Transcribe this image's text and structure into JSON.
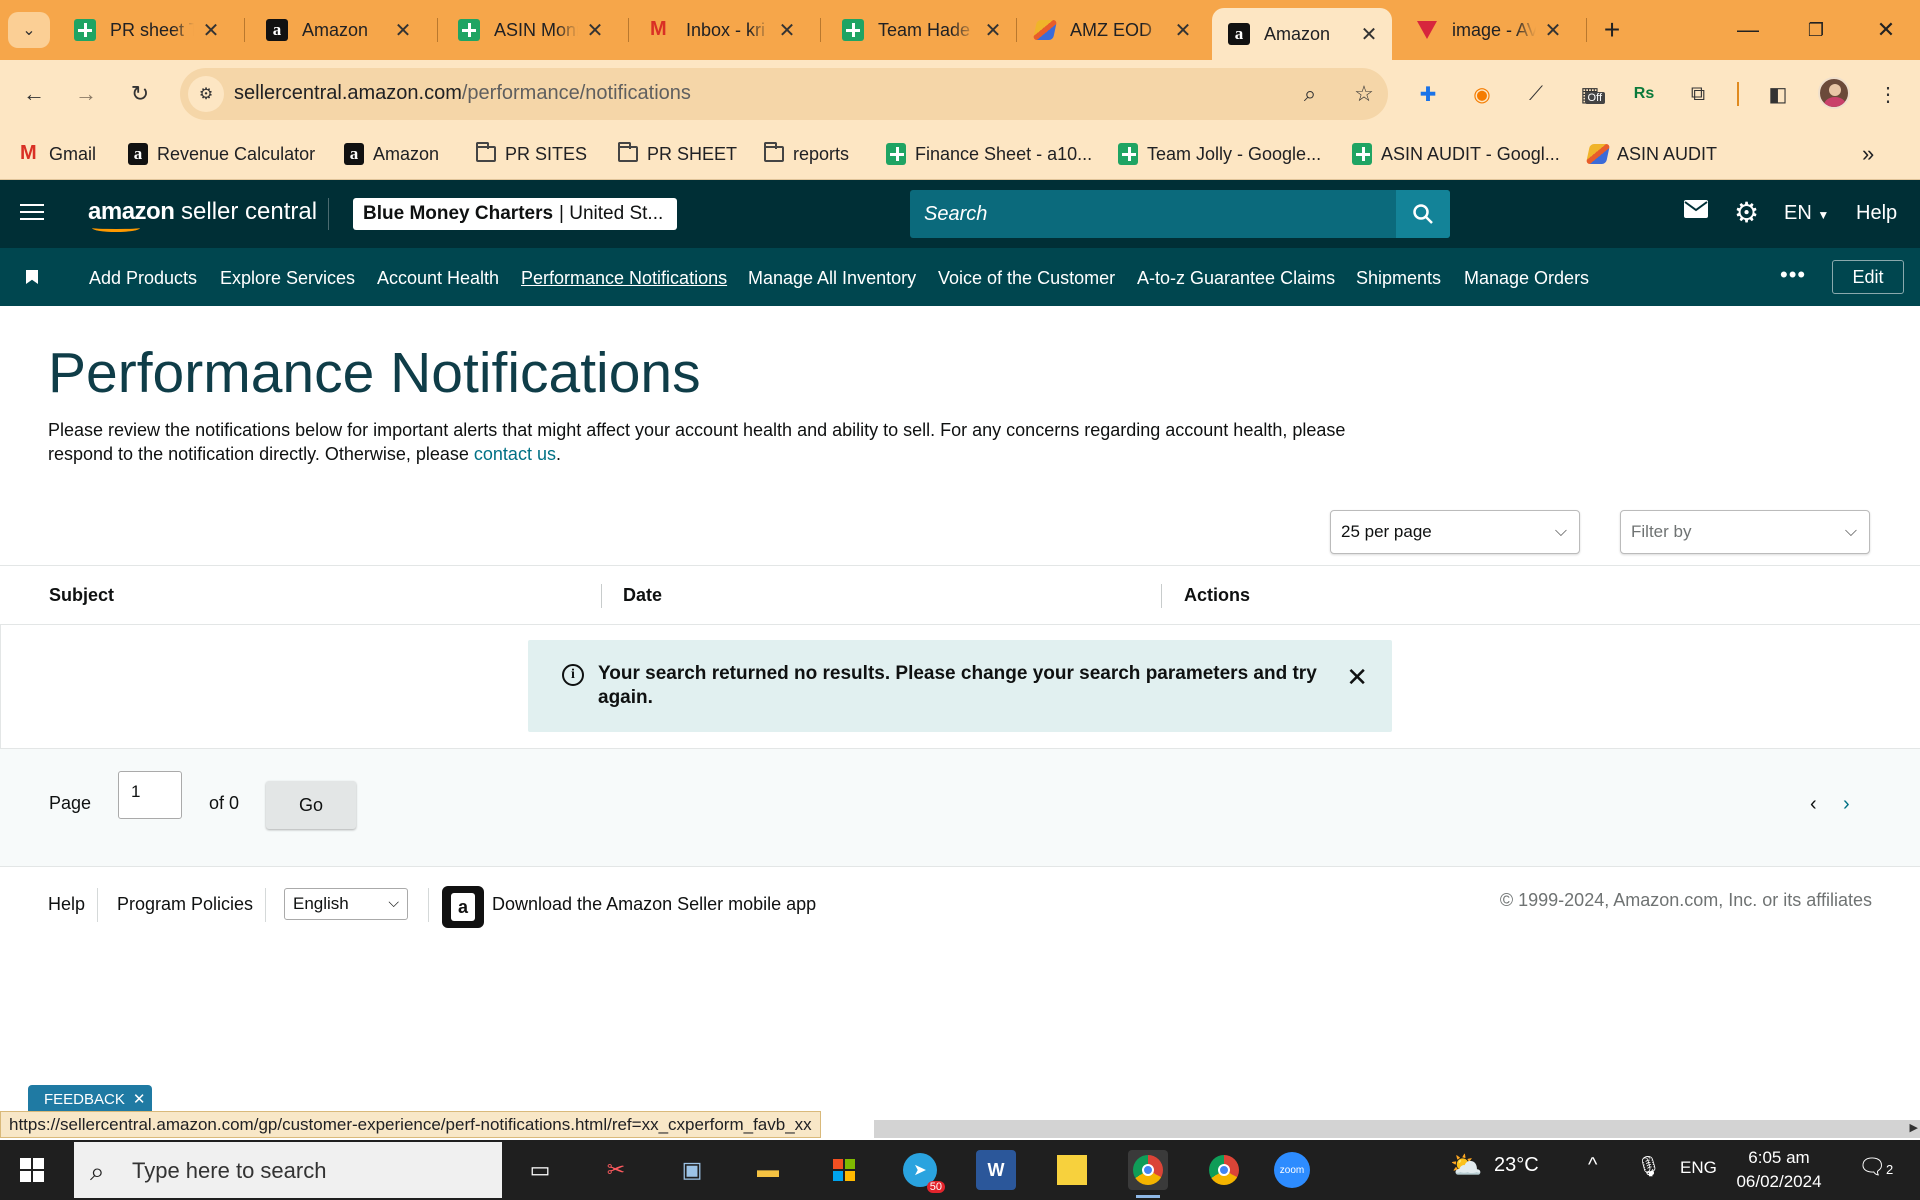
{
  "browser": {
    "tabs": [
      {
        "title": "PR sheet To",
        "icon": "sheets-icon"
      },
      {
        "title": "Amazon",
        "icon": "amazon-icon"
      },
      {
        "title": "ASIN Moni",
        "icon": "sheets-icon"
      },
      {
        "title": "Inbox - kri",
        "icon": "gmail-icon"
      },
      {
        "title": "Team Hade",
        "icon": "sheets-icon"
      },
      {
        "title": "AMZ EOD",
        "icon": "asin-audit-icon"
      },
      {
        "title": "Amazon",
        "icon": "amazon-icon",
        "active": true
      },
      {
        "title": "image - AV",
        "icon": "vpn-icon"
      }
    ],
    "url_host": "sellercentral.amazon.com",
    "url_path": "/performance/notifications",
    "bookmarks": [
      {
        "label": "Gmail",
        "icon": "gmail-icon"
      },
      {
        "label": "Revenue Calculator",
        "icon": "amazon-icon"
      },
      {
        "label": "Amazon",
        "icon": "amazon-icon"
      },
      {
        "label": "PR SITES",
        "icon": "folder-icon"
      },
      {
        "label": "PR SHEET",
        "icon": "folder-icon"
      },
      {
        "label": "reports",
        "icon": "folder-icon"
      },
      {
        "label": "Finance Sheet - a10...",
        "icon": "sheets-icon"
      },
      {
        "label": "Team Jolly - Google...",
        "icon": "sheets-icon"
      },
      {
        "label": "ASIN AUDIT - Googl...",
        "icon": "sheets-icon"
      },
      {
        "label": "ASIN AUDIT",
        "icon": "asin-audit-icon"
      }
    ],
    "extension_badge": "Off",
    "status_url": "https://sellercentral.amazon.com/gp/customer-experience/perf-notifications.html/ref=xx_cxperform_favb_xx"
  },
  "header": {
    "logo_brand": "amazon",
    "logo_product": "seller central",
    "account_name": "Blue Money Charters",
    "account_region": "| United St...",
    "search_placeholder": "Search",
    "language": "EN",
    "help": "Help"
  },
  "nav": {
    "items": [
      "Add Products",
      "Explore Services",
      "Account Health",
      "Performance Notifications",
      "Manage All Inventory",
      "Voice of the Customer",
      "A-to-z Guarantee Claims",
      "Shipments",
      "Manage Orders"
    ],
    "active": "Performance Notifications",
    "edit": "Edit"
  },
  "page": {
    "title": "Performance Notifications",
    "intro_1": "Please review the notifications below for important alerts that might affect your account health and ability to sell. For any concerns regarding account health, please respond to the notification directly. Otherwise, please ",
    "intro_link": "contact us",
    "intro_end": ".",
    "per_page": "25 per page",
    "filter_placeholder": "Filter by",
    "columns": [
      "Subject",
      "Date",
      "Actions"
    ],
    "alert": "Your search returned no results. Please change your search parameters and try again.",
    "pager": {
      "page_label": "Page",
      "current": "1",
      "of_label": "of 0",
      "go": "Go"
    }
  },
  "footer": {
    "help": "Help",
    "policies": "Program Policies",
    "language": "English",
    "app_text": "Download the Amazon Seller mobile app",
    "copyright": "© 1999-2024, Amazon.com, Inc. or its affiliates",
    "feedback": "FEEDBACK"
  },
  "taskbar": {
    "search_placeholder": "Type here to search",
    "telegram_badge": "50",
    "weather": "23°C",
    "lang": "ENG",
    "time": "6:05 am",
    "date": "06/02/2024",
    "notifications": "2"
  },
  "colors": {
    "tab_bar": "#f6a64a",
    "sc_header": "#002f36",
    "sc_nav": "#00464f",
    "alert_bg": "#e1f0f0",
    "link": "#007185"
  }
}
